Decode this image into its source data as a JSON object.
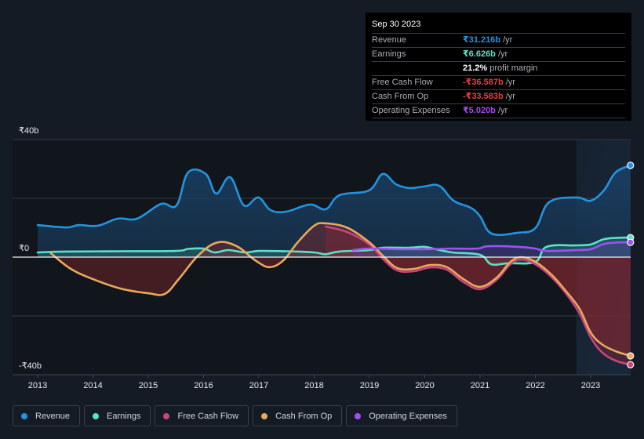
{
  "tooltip": {
    "date": "Sep 30 2023",
    "rows": [
      {
        "label": "Revenue",
        "value": "₹31.216b",
        "unit": " /yr",
        "color": "#2394df"
      },
      {
        "label": "Earnings",
        "value": "₹6.626b",
        "unit": " /yr",
        "color": "#5de0c8"
      },
      {
        "label": "",
        "value": "21.2%",
        "unit": " profit margin",
        "color": "#ffffff"
      },
      {
        "label": "Free Cash Flow",
        "value": "-₹36.587b",
        "unit": " /yr",
        "color": "#e64141"
      },
      {
        "label": "Cash From Op",
        "value": "-₹33.583b",
        "unit": " /yr",
        "color": "#e64141"
      },
      {
        "label": "Operating Expenses",
        "value": "₹5.020b",
        "unit": " /yr",
        "color": "#a24ff0"
      }
    ]
  },
  "legend": [
    {
      "label": "Revenue",
      "color": "#2394df"
    },
    {
      "label": "Earnings",
      "color": "#5de0c8"
    },
    {
      "label": "Free Cash Flow",
      "color": "#c9447f"
    },
    {
      "label": "Cash From Op",
      "color": "#e8a95a"
    },
    {
      "label": "Operating Expenses",
      "color": "#a24ff0"
    }
  ],
  "chart_data": {
    "type": "area",
    "title": "",
    "xlabel": "",
    "ylabel": "",
    "currency": "₹",
    "ylim": [
      -40,
      40
    ],
    "xlim": [
      2012.5,
      2023.72
    ],
    "yticks": [
      {
        "value": 40,
        "label": "₹40b"
      },
      {
        "value": 0,
        "label": "₹0"
      },
      {
        "value": -40,
        "label": "-₹40b"
      }
    ],
    "xticks": [
      "2013",
      "2014",
      "2015",
      "2016",
      "2017",
      "2018",
      "2019",
      "2020",
      "2021",
      "2022",
      "2023"
    ],
    "grid": true,
    "highlight_start": 2022.74,
    "legend_position": "bottom-left",
    "series": [
      {
        "name": "Revenue",
        "color": "#2394df",
        "fill": true,
        "points": [
          [
            2013.0,
            10.9
          ],
          [
            2013.52,
            10.1
          ],
          [
            2013.74,
            10.9
          ],
          [
            2014.09,
            10.7
          ],
          [
            2014.45,
            13.1
          ],
          [
            2014.8,
            13.1
          ],
          [
            2015.23,
            18.1
          ],
          [
            2015.51,
            17.6
          ],
          [
            2015.72,
            28.8
          ],
          [
            2016.04,
            28.3
          ],
          [
            2016.23,
            21.6
          ],
          [
            2016.48,
            27.2
          ],
          [
            2016.73,
            17.6
          ],
          [
            2016.99,
            20.3
          ],
          [
            2017.21,
            16.0
          ],
          [
            2017.5,
            15.5
          ],
          [
            2017.92,
            17.9
          ],
          [
            2018.21,
            16.3
          ],
          [
            2018.46,
            21.1
          ],
          [
            2018.99,
            22.7
          ],
          [
            2019.24,
            28.3
          ],
          [
            2019.48,
            24.8
          ],
          [
            2019.72,
            23.5
          ],
          [
            2019.98,
            24.0
          ],
          [
            2020.26,
            24.3
          ],
          [
            2020.52,
            19.2
          ],
          [
            2020.83,
            16.8
          ],
          [
            2021.0,
            13.9
          ],
          [
            2021.21,
            8.0
          ],
          [
            2021.68,
            8.3
          ],
          [
            2022.0,
            9.9
          ],
          [
            2022.25,
            18.7
          ],
          [
            2022.74,
            20.3
          ],
          [
            2023.0,
            19.2
          ],
          [
            2023.24,
            22.7
          ],
          [
            2023.45,
            28.8
          ],
          [
            2023.72,
            31.216
          ]
        ]
      },
      {
        "name": "Earnings",
        "color": "#5de0c8",
        "fill": true,
        "points": [
          [
            2013.0,
            1.6
          ],
          [
            2013.5,
            1.9
          ],
          [
            2014.5,
            2.0
          ],
          [
            2015.5,
            2.1
          ],
          [
            2015.72,
            2.8
          ],
          [
            2016.0,
            2.9
          ],
          [
            2016.2,
            1.6
          ],
          [
            2016.45,
            2.4
          ],
          [
            2016.75,
            1.6
          ],
          [
            2017.0,
            2.1
          ],
          [
            2017.5,
            2.0
          ],
          [
            2018.0,
            1.6
          ],
          [
            2018.21,
            1.0
          ],
          [
            2018.45,
            1.9
          ],
          [
            2019.0,
            2.4
          ],
          [
            2019.24,
            3.2
          ],
          [
            2019.7,
            3.2
          ],
          [
            2020.0,
            3.5
          ],
          [
            2020.2,
            2.7
          ],
          [
            2020.5,
            1.6
          ],
          [
            2021.0,
            0.8
          ],
          [
            2021.2,
            -2.4
          ],
          [
            2021.5,
            -2.1
          ],
          [
            2022.0,
            -1.6
          ],
          [
            2022.2,
            3.5
          ],
          [
            2022.74,
            4.0
          ],
          [
            2023.0,
            4.3
          ],
          [
            2023.24,
            6.1
          ],
          [
            2023.5,
            6.6
          ],
          [
            2023.72,
            6.626
          ]
        ]
      },
      {
        "name": "Free Cash Flow",
        "color": "#c9447f",
        "fill": true,
        "points": [
          [
            2018.21,
            10.4
          ],
          [
            2018.6,
            8.5
          ],
          [
            2019.0,
            4.3
          ],
          [
            2019.24,
            -0.5
          ],
          [
            2019.5,
            -4.5
          ],
          [
            2019.8,
            -4.8
          ],
          [
            2020.1,
            -3.5
          ],
          [
            2020.4,
            -4.3
          ],
          [
            2020.7,
            -8.5
          ],
          [
            2021.0,
            -10.9
          ],
          [
            2021.3,
            -7.7
          ],
          [
            2021.55,
            -2.4
          ],
          [
            2021.75,
            -0.8
          ],
          [
            2022.0,
            -2.4
          ],
          [
            2022.3,
            -6.9
          ],
          [
            2022.55,
            -12.3
          ],
          [
            2022.8,
            -19.2
          ],
          [
            2023.0,
            -27.2
          ],
          [
            2023.2,
            -32.3
          ],
          [
            2023.45,
            -35.2
          ],
          [
            2023.72,
            -36.587
          ]
        ]
      },
      {
        "name": "Cash From Op",
        "color": "#e8a95a",
        "fill": true,
        "points": [
          [
            2013.24,
            1.3
          ],
          [
            2013.6,
            -4.0
          ],
          [
            2014.0,
            -7.5
          ],
          [
            2014.5,
            -10.7
          ],
          [
            2015.0,
            -12.3
          ],
          [
            2015.3,
            -12.5
          ],
          [
            2015.55,
            -7.5
          ],
          [
            2015.9,
            0.5
          ],
          [
            2016.25,
            5.0
          ],
          [
            2016.6,
            3.7
          ],
          [
            2016.95,
            -1.3
          ],
          [
            2017.2,
            -3.4
          ],
          [
            2017.45,
            -1.0
          ],
          [
            2017.7,
            5.0
          ],
          [
            2018.0,
            10.7
          ],
          [
            2018.21,
            11.5
          ],
          [
            2018.6,
            10.0
          ],
          [
            2019.0,
            5.0
          ],
          [
            2019.24,
            0.5
          ],
          [
            2019.5,
            -3.7
          ],
          [
            2019.8,
            -4.0
          ],
          [
            2020.1,
            -2.7
          ],
          [
            2020.4,
            -3.4
          ],
          [
            2020.7,
            -7.5
          ],
          [
            2021.0,
            -10.1
          ],
          [
            2021.3,
            -7.0
          ],
          [
            2021.55,
            -1.6
          ],
          [
            2021.75,
            0.0
          ],
          [
            2022.0,
            -1.6
          ],
          [
            2022.3,
            -6.1
          ],
          [
            2022.55,
            -11.5
          ],
          [
            2022.8,
            -17.6
          ],
          [
            2023.0,
            -25.6
          ],
          [
            2023.2,
            -29.6
          ],
          [
            2023.45,
            -32.0
          ],
          [
            2023.72,
            -33.583
          ]
        ]
      },
      {
        "name": "Operating Expenses",
        "color": "#a24ff0",
        "fill": true,
        "points": [
          [
            2018.7,
            2.4
          ],
          [
            2019.0,
            2.9
          ],
          [
            2019.5,
            2.7
          ],
          [
            2020.0,
            2.7
          ],
          [
            2020.5,
            2.9
          ],
          [
            2020.95,
            2.9
          ],
          [
            2021.15,
            3.7
          ],
          [
            2021.7,
            3.5
          ],
          [
            2022.0,
            2.9
          ],
          [
            2022.2,
            2.1
          ],
          [
            2022.74,
            2.4
          ],
          [
            2023.0,
            2.7
          ],
          [
            2023.24,
            4.5
          ],
          [
            2023.5,
            5.0
          ],
          [
            2023.72,
            5.02
          ]
        ]
      }
    ]
  }
}
